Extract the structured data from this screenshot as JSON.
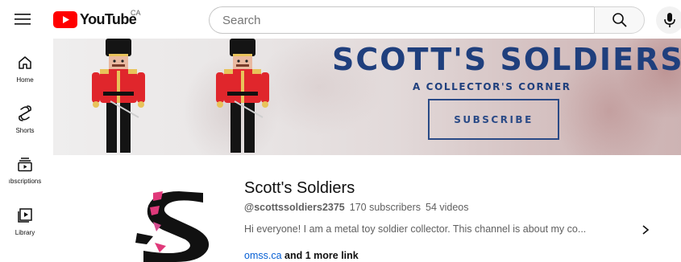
{
  "header": {
    "logo_text": "YouTube",
    "country_code": "CA",
    "search_placeholder": "Search",
    "icons": {
      "menu": "hamburger-menu-icon",
      "search": "search-icon",
      "mic": "microphone-icon"
    },
    "logo_color": "#ff0000"
  },
  "sidebar": {
    "items": [
      {
        "label": "Home",
        "icon": "home-icon"
      },
      {
        "label": "Shorts",
        "icon": "shorts-icon"
      },
      {
        "label": "ıbscriptions",
        "icon": "subscriptions-icon"
      },
      {
        "label": "Library",
        "icon": "library-icon"
      }
    ]
  },
  "banner": {
    "title": "SCOTT'S SOLDIERS",
    "subtitle": "A COLLECTOR'S CORNER",
    "subscribe_label": "SUBSCRIBE",
    "title_color": "#1f3f7d"
  },
  "channel": {
    "name": "Scott's Soldiers",
    "handle": "@scottssoldiers2375",
    "subscribers": "170 subscribers",
    "videos": "54 videos",
    "description": "Hi everyone! I am a metal toy soldier collector. This channel is about my co...",
    "link_text": "omss.ca",
    "more_links": "and 1 more link",
    "link_color": "#065fd4",
    "avatar_icon": "channel-logo-s"
  }
}
